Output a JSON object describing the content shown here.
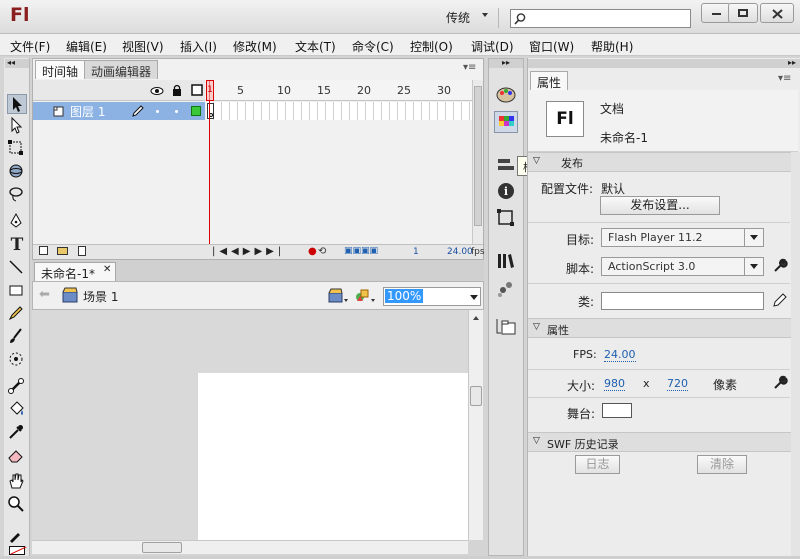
{
  "app": {
    "logo": "Fl",
    "workspace": "传统",
    "search_placeholder": ""
  },
  "window_controls": {
    "minimize": "—",
    "restore": "□",
    "close": "✕"
  },
  "menu": [
    "文件(F)",
    "编辑(E)",
    "视图(V)",
    "插入(I)",
    "修改(M)",
    "文本(T)",
    "命令(C)",
    "控制(O)",
    "调试(D)",
    "窗口(W)",
    "帮助(H)"
  ],
  "timeline": {
    "tabs": [
      "时间轴",
      "动画编辑器"
    ],
    "ruler": [
      "1",
      "5",
      "10",
      "15",
      "20",
      "25",
      "30"
    ],
    "layer_name": "图层 1",
    "current_frame": "1",
    "fps": "24.00",
    "fps_unit": "fps"
  },
  "document": {
    "tab_label": "未命名-1*",
    "scene": "场景 1",
    "zoom": "100%"
  },
  "tooltip": "样本",
  "properties": {
    "tab": "属性",
    "doc_type": "文档",
    "doc_name": "未命名-1",
    "publish_section": "发布",
    "profile_label": "配置文件:",
    "profile_value": "默认",
    "publish_settings": "发布设置...",
    "target_label": "目标:",
    "target_value": "Flash Player 11.2",
    "script_label": "脚本:",
    "script_value": "ActionScript 3.0",
    "class_label": "类:",
    "props_section": "属性",
    "fps_label": "FPS:",
    "fps_value": "24.00",
    "size_label": "大小:",
    "width": "980",
    "x": "x",
    "height": "720",
    "unit": "像素",
    "stage_label": "舞台:",
    "stage_color": "#ffffff",
    "swf_section": "SWF 历史记录",
    "log_button": "日志",
    "clear_button": "清除"
  },
  "colors": {
    "accent": "#2060b0",
    "selection": "#8cb2e3",
    "playhead": "#dd0000"
  }
}
